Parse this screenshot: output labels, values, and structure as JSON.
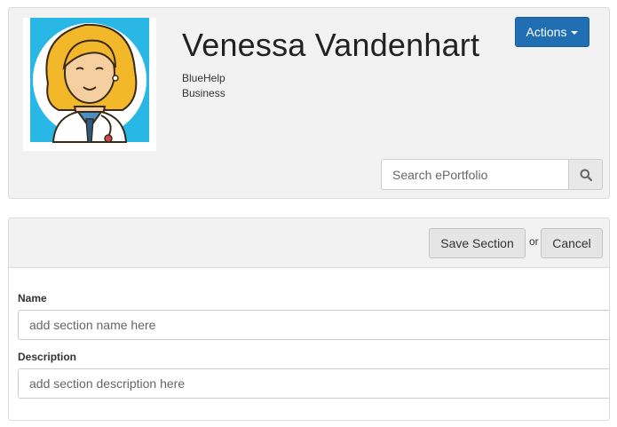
{
  "profile": {
    "name": "Venessa Vandenhart",
    "organization": "BlueHelp",
    "department": "Business",
    "avatar_icon": "doctor-avatar-icon"
  },
  "actions": {
    "label": "Actions",
    "icon": "caret-down-icon",
    "color": "#1f6fb2"
  },
  "search": {
    "placeholder": "Search ePortfolio",
    "value": "",
    "icon": "search-icon"
  },
  "section_form": {
    "save_label": "Save Section",
    "or_text": "or",
    "cancel_label": "Cancel",
    "name_label": "Name",
    "name_placeholder": "add section name here",
    "name_value": "",
    "description_label": "Description",
    "description_placeholder": "add section description here",
    "description_value": ""
  }
}
